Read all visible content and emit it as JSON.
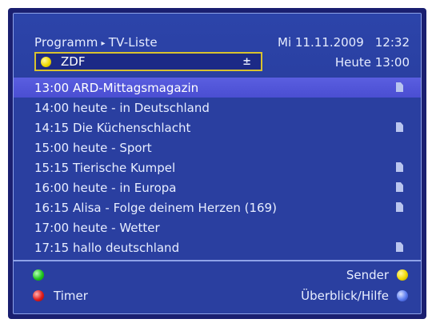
{
  "header": {
    "breadcrumb_root": "Programm",
    "breadcrumb_sep": "▸",
    "breadcrumb_page": "TV-Liste",
    "date": "Mi 11.11.2009",
    "time": "12:32",
    "channel": "ZDF",
    "channel_arrow": "±",
    "heute": "Heute 13:00"
  },
  "programs": [
    {
      "time": "13:00",
      "title": "ARD-Mittagsmagazin",
      "info": true,
      "selected": true
    },
    {
      "time": "14:00",
      "title": "heute - in Deutschland",
      "info": false
    },
    {
      "time": "14:15",
      "title": "Die Küchenschlacht",
      "info": true
    },
    {
      "time": "15:00",
      "title": "heute - Sport",
      "info": false
    },
    {
      "time": "15:15",
      "title": "Tierische Kumpel",
      "info": true
    },
    {
      "time": "16:00",
      "title": "heute - in Europa",
      "info": true
    },
    {
      "time": "16:15",
      "title": "Alisa - Folge deinem Herzen (169)",
      "info": true
    },
    {
      "time": "17:00",
      "title": "heute - Wetter",
      "info": false
    },
    {
      "time": "17:15",
      "title": "hallo deutschland",
      "info": true
    }
  ],
  "footer": {
    "red_label": "Timer",
    "yellow_label": "Sender",
    "blue_label": "Überblick/Hilfe"
  },
  "colors": {
    "background": "#2a3fa0",
    "selection": "#5a5ee0",
    "highlight_border": "#d8c22e"
  }
}
